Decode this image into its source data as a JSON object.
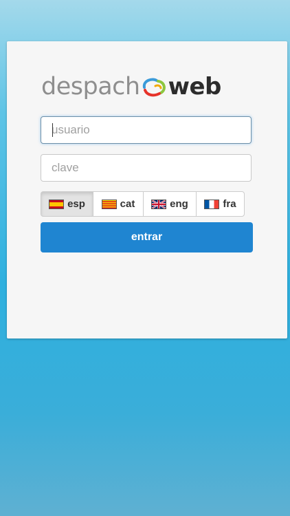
{
  "logo": {
    "text_left": "despach",
    "text_right": "web",
    "swirl_colors": [
      "#3b9bd9",
      "#8cc63f",
      "#e6332a",
      "#f2a900"
    ]
  },
  "form": {
    "username_placeholder": "usuario",
    "password_placeholder": "clave",
    "submit_label": "entrar",
    "submit_color": "#1f85d1"
  },
  "languages": [
    {
      "code": "esp",
      "label": "esp",
      "flag": "spain-flag-icon",
      "active": true
    },
    {
      "code": "cat",
      "label": "cat",
      "flag": "catalonia-flag-icon",
      "active": false
    },
    {
      "code": "eng",
      "label": "eng",
      "flag": "uk-flag-icon",
      "active": false
    },
    {
      "code": "fra",
      "label": "fra",
      "flag": "france-flag-icon",
      "active": false
    }
  ]
}
